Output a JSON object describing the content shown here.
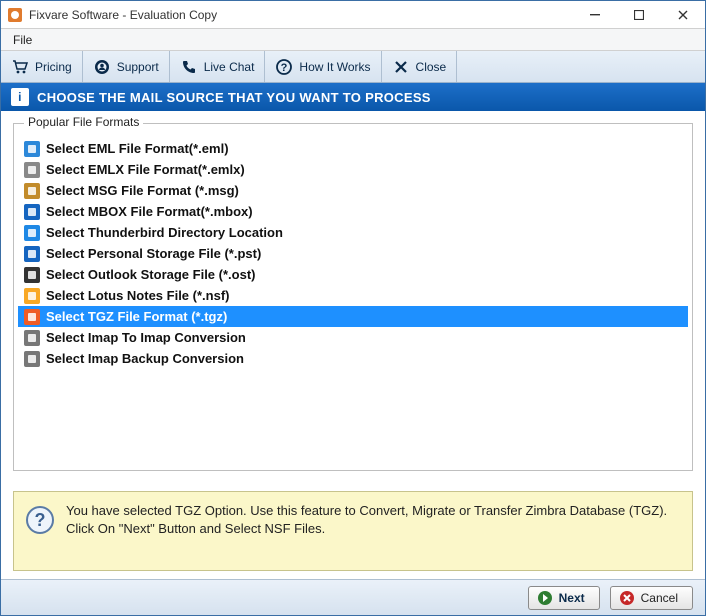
{
  "window": {
    "title": "Fixvare Software - Evaluation Copy"
  },
  "menubar": {
    "file": "File"
  },
  "toolbar": {
    "pricing": "Pricing",
    "support": "Support",
    "livechat": "Live Chat",
    "howworks": "How It Works",
    "close": "Close"
  },
  "banner": {
    "text": "CHOOSE THE MAIL SOURCE THAT YOU WANT TO PROCESS"
  },
  "group": {
    "title": "Popular File Formats"
  },
  "formats": [
    {
      "label": "Select EML File Format(*.eml)",
      "selected": false,
      "iconColor": "#2c88d9"
    },
    {
      "label": "Select EMLX File Format(*.emlx)",
      "selected": false,
      "iconColor": "#888888"
    },
    {
      "label": "Select MSG File Format (*.msg)",
      "selected": false,
      "iconColor": "#c28b2a"
    },
    {
      "label": "Select MBOX File Format(*.mbox)",
      "selected": false,
      "iconColor": "#1565c0"
    },
    {
      "label": "Select Thunderbird Directory Location",
      "selected": false,
      "iconColor": "#1e88e5"
    },
    {
      "label": "Select Personal Storage File (*.pst)",
      "selected": false,
      "iconColor": "#1565c0"
    },
    {
      "label": "Select Outlook Storage File (*.ost)",
      "selected": false,
      "iconColor": "#333333"
    },
    {
      "label": "Select Lotus Notes File (*.nsf)",
      "selected": false,
      "iconColor": "#f9a825"
    },
    {
      "label": "Select TGZ File Format (*.tgz)",
      "selected": true,
      "iconColor": "#ef5b25"
    },
    {
      "label": "Select Imap To Imap Conversion",
      "selected": false,
      "iconColor": "#777777"
    },
    {
      "label": "Select Imap Backup Conversion",
      "selected": false,
      "iconColor": "#777777"
    }
  ],
  "info": {
    "message": "You have selected TGZ Option. Use this feature to Convert, Migrate or Transfer Zimbra Database (TGZ). Click On \"Next\" Button and Select NSF Files."
  },
  "footer": {
    "next": "Next",
    "cancel": "Cancel"
  }
}
